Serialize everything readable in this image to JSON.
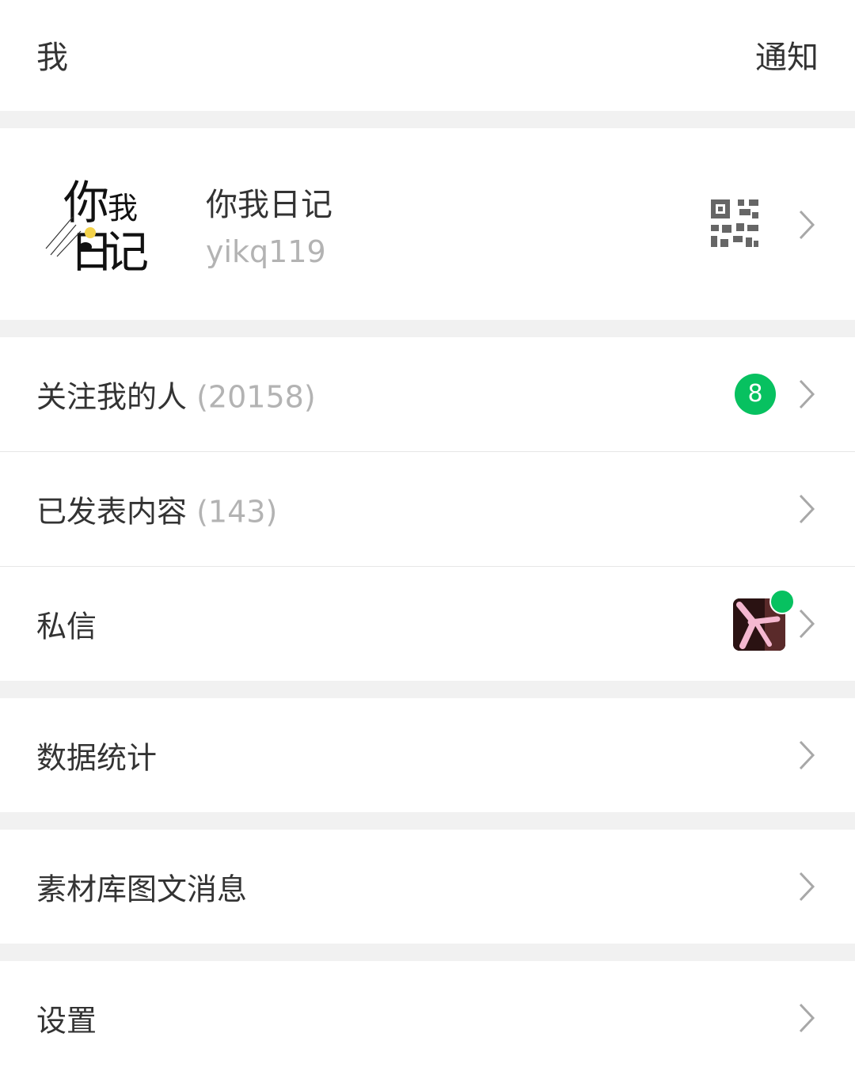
{
  "header": {
    "title": "我",
    "notify_label": "通知"
  },
  "profile": {
    "name": "你我日记",
    "handle": "yikq119",
    "logo_text": "你我日记"
  },
  "menu": {
    "followers": {
      "label": "关注我的人",
      "count": "(20158)",
      "badge": "8"
    },
    "published": {
      "label": "已发表内容",
      "count": "(143)"
    },
    "messages": {
      "label": "私信"
    },
    "stats": {
      "label": "数据统计"
    },
    "materials": {
      "label": "素材库图文消息"
    },
    "settings": {
      "label": "设置"
    }
  },
  "colors": {
    "accent": "#07c160",
    "muted": "#b3b3b3",
    "text": "#333333",
    "background": "#f1f1f1"
  },
  "icons": [
    "qr-code-icon",
    "chevron-right-icon"
  ]
}
